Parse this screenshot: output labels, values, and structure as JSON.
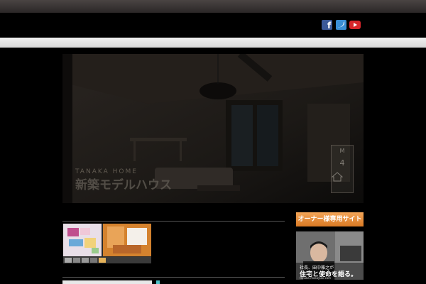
{
  "header": {
    "social": [
      {
        "icon": "facebook-icon",
        "color": "#3b5998"
      },
      {
        "icon": "twitter-icon",
        "color": "#3b8fd6"
      },
      {
        "icon": "youtube-icon",
        "color": "#d8262a"
      }
    ]
  },
  "hero": {
    "subtitle": "TANAKA HOME",
    "title": "新築モデルハウス",
    "badge_top": "M",
    "badge_number": "4"
  },
  "sidebar": {
    "owner_banner": "オーナー様専用サイト",
    "owner_banner_color": "#e88f3a",
    "president_caption_1": "社長、田中雅之が",
    "president_caption_2": "住宅と使命を語る。",
    "president_url": "tanaka-masayuki.com"
  }
}
